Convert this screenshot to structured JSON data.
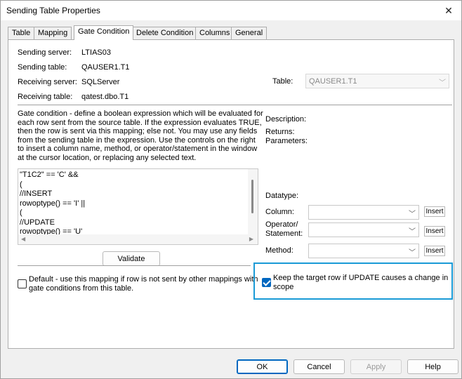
{
  "window": {
    "title": "Sending Table Properties"
  },
  "tabs": [
    "Table",
    "Mapping",
    "Gate Condition",
    "Delete Condition",
    "Columns",
    "General"
  ],
  "active_tab": "Gate Condition",
  "info": {
    "sending_server_label": "Sending server:",
    "sending_server_value": "LTIAS03",
    "sending_table_label": "Sending table:",
    "sending_table_value": "QAUSER1.T1",
    "receiving_server_label": "Receiving server:",
    "receiving_server_value": "SQLServer",
    "receiving_table_label": "Receiving table:",
    "receiving_table_value": "qatest.dbo.T1"
  },
  "table_select": {
    "label": "Table:",
    "value": "QAUSER1.T1"
  },
  "description": "Gate condition - define a boolean expression which will be evaluated for each row sent from the source table.  If the expression evaluates TRUE, then the row is sent via this mapping; else not.  You may use any fields from the sending table in the expression.  Use the controls on the right to insert a column name, method, or operator/statement in the window at the cursor location, or replacing any selected text.",
  "editor_lines": [
    "\"T1C2\" == 'C' &&",
    "(",
    "//INSERT",
    "rowoptype() == 'I' ||",
    "(",
    "//UPDATE",
    "rowoptype() == 'U'"
  ],
  "right_panel": {
    "description_label": "Description:",
    "returns_label": "Returns:",
    "parameters_label": "Parameters:",
    "datatype_label": "Datatype:",
    "column_label": "Column:",
    "operator_label_line1": "Operator/",
    "operator_label_line2": "Statement:",
    "method_label": "Method:",
    "insert_label": "Insert"
  },
  "validate_label": "Validate",
  "default_checkbox": {
    "line1": "Default - use this mapping if row is not sent by other mappings with",
    "line2": "gate conditions from this table.",
    "checked": false
  },
  "keep_checkbox": {
    "line1": "Keep the target row if UPDATE causes a change in",
    "line2": "scope",
    "checked": true
  },
  "buttons": {
    "ok": "OK",
    "cancel": "Cancel",
    "apply": "Apply",
    "help": "Help"
  },
  "colors": {
    "accent": "#0067c0",
    "highlight": "#1a9ad6"
  }
}
